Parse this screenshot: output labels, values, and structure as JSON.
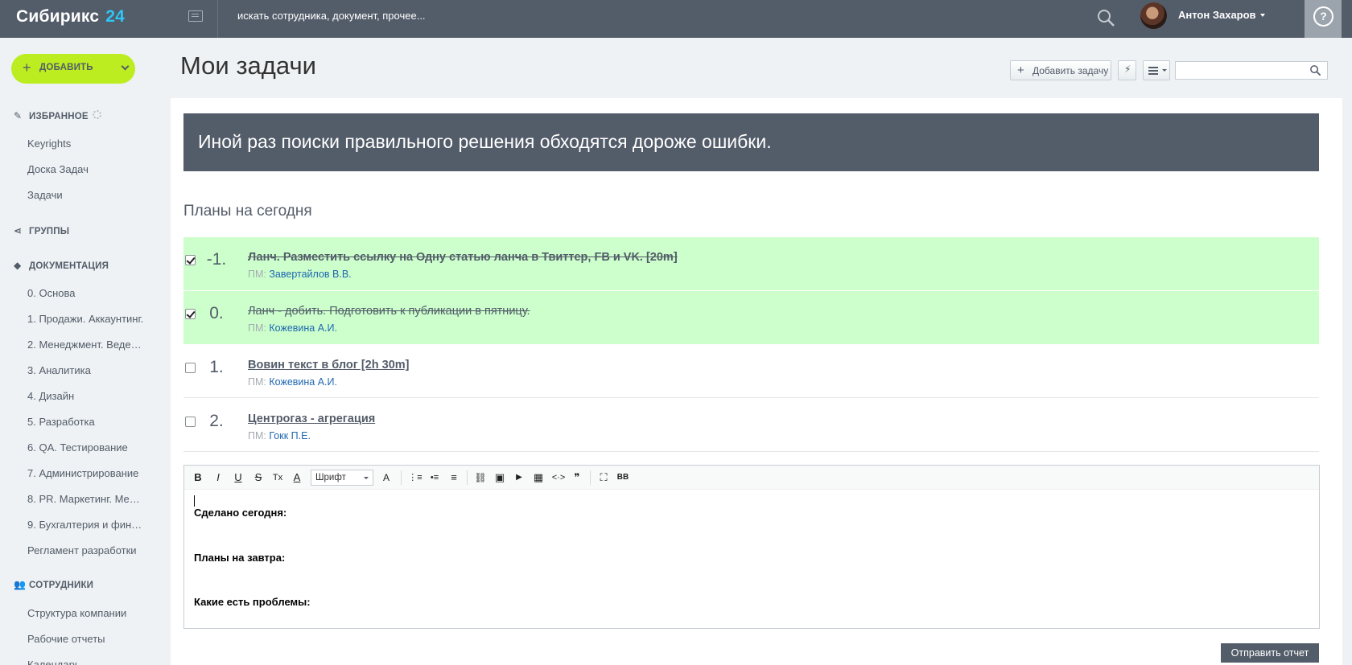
{
  "topbar": {
    "logo_text": "Сибирикс",
    "logo_num": "24",
    "search_placeholder": "искать сотрудника, документ, прочее...",
    "user_name": "Антон Захаров",
    "help": "?"
  },
  "sidebar": {
    "add_label": "ДОБАВИТЬ",
    "favorites": {
      "title": "ИЗБРАННОЕ",
      "items": [
        "Keyrights",
        "Доска Задач",
        "Задачи"
      ]
    },
    "groups_title": "ГРУППЫ",
    "docs": {
      "title": "ДОКУМЕНТАЦИЯ",
      "items": [
        "0. Основа",
        "1. Продажи. Аккаунтинг.",
        "2. Менеджмент. Веде…",
        "3. Аналитика",
        "4. Дизайн",
        "5. Разработка",
        "6. QA. Тестирование",
        "7. Администрирование",
        "8. PR. Маркетинг. Ме…",
        "9. Бухгалтерия и фин…",
        "Регламент разработки"
      ]
    },
    "staff": {
      "title": "СОТРУДНИКИ",
      "items": [
        "Структура компании",
        "Рабочие отчеты",
        "Календарь"
      ]
    }
  },
  "page": {
    "title": "Мои задачи",
    "toolbar": {
      "add_task": "Добавить задачу",
      "bolt": "⚡",
      "search_value": ""
    }
  },
  "quote": "Иной раз поиски правильного решения обходятся дороже ошибки.",
  "plans_title": "Планы на сегодня",
  "tasks": [
    {
      "num": "-1.",
      "title": "Ланч. Разместить ссылку на Одну статью ланча в Твиттер, FB и VK. [20m]",
      "pm_label": "ПМ:",
      "pm": "Завертайлов В.В.",
      "done": true
    },
    {
      "num": "0.",
      "title": "Ланч - добить. Подготовить к публикации в пятницу.",
      "pm_label": "ПМ:",
      "pm": "Кожевина А.И.",
      "done": true
    },
    {
      "num": "1.",
      "title": "Вовин текст в блог [2h 30m]",
      "pm_label": "ПМ:",
      "pm": "Кожевина А.И.",
      "done": false
    },
    {
      "num": "2.",
      "title": "Центрогаз - агрегация",
      "pm_label": "ПМ:",
      "pm": "Гокк П.Е.",
      "done": false
    }
  ],
  "editor": {
    "toolbar": {
      "bold": "B",
      "italic": "I",
      "underline": "U",
      "strike": "S",
      "clear": "Tx",
      "color": "A",
      "font": "Шрифт",
      "size": "A",
      "ol": "⋮≡",
      "ul": "•≡",
      "align": "≡",
      "link": "⛓",
      "image": "▣",
      "video": "▶",
      "table": "▦",
      "code": "<·>",
      "quote": "❞",
      "fullscreen": "⛶",
      "bbcode": "BB"
    },
    "lines": [
      "Сделано сегодня:",
      "Планы на завтра:",
      "Какие есть проблемы:"
    ]
  },
  "send_label": "Отправить отчет"
}
